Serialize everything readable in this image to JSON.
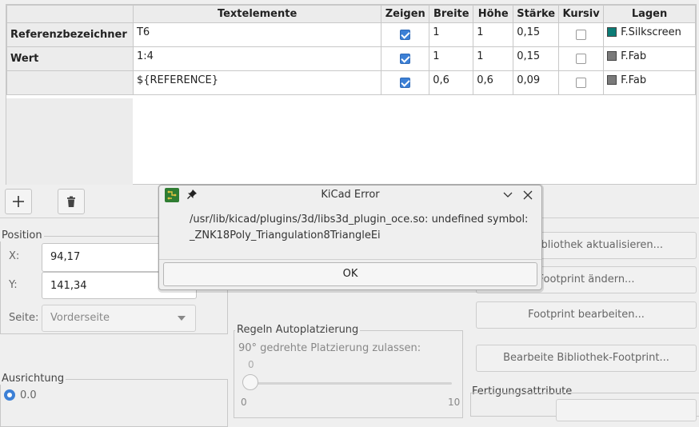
{
  "grid": {
    "headers": [
      "",
      "Textelemente",
      "Zeigen",
      "Breite",
      "Höhe",
      "Stärke",
      "Kursiv",
      "Lagen"
    ],
    "rows": [
      {
        "label": "Referenzbezeichner",
        "text": "T6",
        "show": true,
        "width": "1",
        "height": "1",
        "thickness": "0,15",
        "italic": false,
        "layer": "F.Silkscreen",
        "layer_color": "#0c7c76"
      },
      {
        "label": "Wert",
        "text": "1:4",
        "show": true,
        "width": "1",
        "height": "1",
        "thickness": "0,15",
        "italic": false,
        "layer": "F.Fab",
        "layer_color": "#7a7a7a"
      },
      {
        "label": "",
        "text": "${REFERENCE}",
        "show": true,
        "width": "0,6",
        "height": "0,6",
        "thickness": "0,09",
        "italic": false,
        "layer": "F.Fab",
        "layer_color": "#7a7a7a"
      }
    ]
  },
  "toolbar": {
    "add_icon": "plus-icon",
    "delete_icon": "trash-icon"
  },
  "position": {
    "title": "Position",
    "x_label": "X:",
    "x_value": "94,17",
    "y_label": "Y:",
    "y_value": "141,34",
    "side_label": "Seite:",
    "side_value": "Vorderseite"
  },
  "autoplace": {
    "title": "Regeln Autoplatzierung",
    "rotate90_label": "90° gedrehte Platzierung zulassen:",
    "slider_value": "0",
    "slider_min": "0",
    "slider_max": "10"
  },
  "orientation": {
    "title": "Ausrichtung",
    "option_0": "0.0"
  },
  "side_buttons": {
    "update_from_lib": "aus Bibliothek aktualisieren...",
    "change_footprint": "Footprint ändern...",
    "edit_footprint": "Footprint bearbeiten...",
    "edit_lib_footprint": "Bearbeite Bibliothek-Footprint..."
  },
  "fab": {
    "title": "Fertigungsattribute"
  },
  "dialog": {
    "title": "KiCad Error",
    "message_line1": "/usr/lib/kicad/plugins/3d/libs3d_plugin_oce.so: undefined symbol:",
    "message_line2": "_ZNK18Poly_Triangulation8TriangleEi",
    "ok_label": "OK"
  },
  "colors": {
    "accent": "#3c80d6",
    "silkscreen": "#0c7c76",
    "fab": "#7a7a7a"
  }
}
